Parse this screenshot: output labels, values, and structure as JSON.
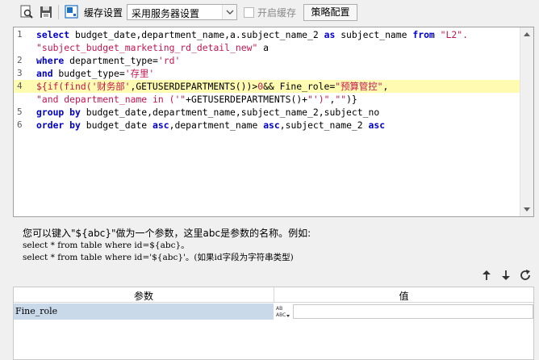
{
  "toolbar": {
    "cache_settings_label": "缓存设置",
    "cache_select_value": "采用服务器设置",
    "enable_cache_label": "开启缓存",
    "strategy_button_label": "策略配置",
    "enable_cache_checked": false
  },
  "editor": {
    "lines": [
      {
        "number": "1",
        "highlight": false,
        "tokens": [
          {
            "t": "select",
            "c": "kw"
          },
          {
            "t": " budget_date,department_name,a.subject_name_2 ",
            "c": "plain"
          },
          {
            "t": "as",
            "c": "kw"
          },
          {
            "t": " subject_name ",
            "c": "plain"
          },
          {
            "t": "from",
            "c": "kw"
          },
          {
            "t": " ",
            "c": "plain"
          },
          {
            "t": "\"L2\".",
            "c": "str"
          }
        ]
      },
      {
        "number": "",
        "highlight": false,
        "tokens": [
          {
            "t": "\"subject_budget_marketing_rd_detail_new\"",
            "c": "str"
          },
          {
            "t": " a",
            "c": "plain"
          }
        ]
      },
      {
        "number": "2",
        "highlight": false,
        "tokens": [
          {
            "t": "where",
            "c": "kw"
          },
          {
            "t": " department_type=",
            "c": "plain"
          },
          {
            "t": "'rd'",
            "c": "str"
          }
        ]
      },
      {
        "number": "3",
        "highlight": false,
        "tokens": [
          {
            "t": "and",
            "c": "kw"
          },
          {
            "t": " budget_type=",
            "c": "plain"
          },
          {
            "t": "'存里'",
            "c": "str"
          }
        ]
      },
      {
        "number": "4",
        "highlight": true,
        "tokens": [
          {
            "t": "${if(find(",
            "c": "str"
          },
          {
            "t": "'财务部'",
            "c": "str"
          },
          {
            "t": ",GETUSERDEPARTMENTS())>",
            "c": "plain"
          },
          {
            "t": "0",
            "c": "str"
          },
          {
            "t": "&& Fine_role=",
            "c": "plain"
          },
          {
            "t": "\"预算管控\"",
            "c": "str"
          },
          {
            "t": ",",
            "c": "plain"
          }
        ]
      },
      {
        "number": "",
        "highlight": false,
        "tokens": [
          {
            "t": "\"and department_name in ('\"",
            "c": "str"
          },
          {
            "t": "+GETUSERDEPARTMENTS()+",
            "c": "plain"
          },
          {
            "t": "\"')\"",
            "c": "str"
          },
          {
            "t": ",",
            "c": "plain"
          },
          {
            "t": "\"\"",
            "c": "str"
          },
          {
            "t": ")}",
            "c": "plain"
          }
        ]
      },
      {
        "number": "5",
        "highlight": false,
        "tokens": [
          {
            "t": "group by",
            "c": "kw"
          },
          {
            "t": " budget_date,department_name,subject_name_2,subject_no",
            "c": "plain"
          }
        ]
      },
      {
        "number": "6",
        "highlight": false,
        "tokens": [
          {
            "t": "order by",
            "c": "kw"
          },
          {
            "t": " budget_date ",
            "c": "plain"
          },
          {
            "t": "asc",
            "c": "kw"
          },
          {
            "t": ",department_name ",
            "c": "plain"
          },
          {
            "t": "asc",
            "c": "kw"
          },
          {
            "t": ",subject_name_2 ",
            "c": "plain"
          },
          {
            "t": "asc",
            "c": "kw"
          }
        ]
      }
    ]
  },
  "hint": {
    "line1": "您可以键入\"${abc}\"做为一个参数，这里abc是参数的名称。例如:",
    "line2": "select * from table where id=${abc}。",
    "line3": "select * from table where id='${abc}'。(如果id字段为字符串类型)"
  },
  "params": {
    "col_param": "参数",
    "col_value": "值",
    "rows": [
      {
        "name": "Fine_role",
        "value": ""
      }
    ]
  },
  "colors": {
    "keyword": "#0000cc",
    "string": "#c4154f",
    "highlight": "#fffbb0",
    "selected_row": "#cad9ea"
  }
}
